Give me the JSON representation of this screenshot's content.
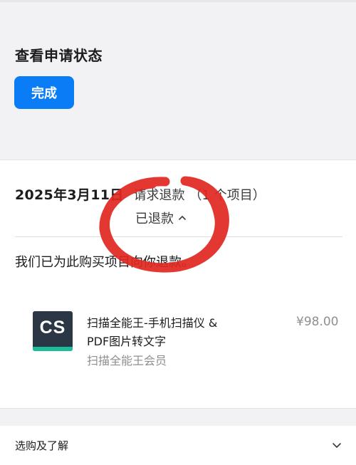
{
  "header": {
    "title": "查看申请状态",
    "done_label": "完成"
  },
  "request": {
    "date": "2025年3月11日",
    "type": "请求退款",
    "count": "（1 个项目）",
    "status": "已退款"
  },
  "refund_message": "我们已为此购买项目向你退款。",
  "item": {
    "icon_text": "CS",
    "name": "扫描全能王-手机扫描仪 & PDF图片转文字",
    "subtitle": "扫描全能王会员",
    "price": "¥98.00"
  },
  "footer": {
    "learn_label": "选购及了解"
  },
  "colors": {
    "accent": "#0a7cf5",
    "annotation": "#e0271f",
    "icon_background": "#2b3744",
    "icon_stripe": "#1bbd9a"
  }
}
